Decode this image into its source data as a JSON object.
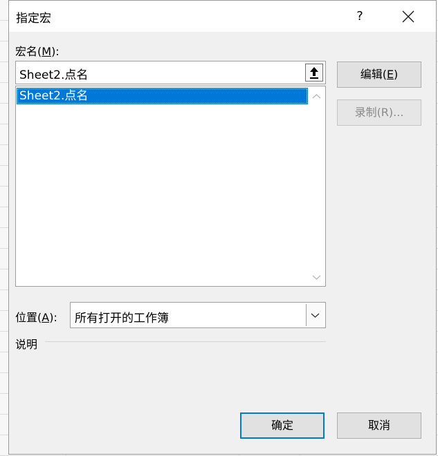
{
  "dialog": {
    "title": "指定宏",
    "help_label": "?",
    "macro_name_label_prefix": "宏名(",
    "macro_name_label_key": "M",
    "macro_name_label_suffix": "):",
    "macro_name_value": "Sheet2.点名",
    "macro_list": [
      "Sheet2.点名"
    ],
    "edit_button_prefix": "编辑(",
    "edit_button_key": "E",
    "edit_button_suffix": ")",
    "record_button": "录制(R)...",
    "location_label_prefix": "位置(",
    "location_label_key": "A",
    "location_label_suffix": "):",
    "location_value": "所有打开的工作簿",
    "description_label": "说明",
    "ok_button": "确定",
    "cancel_button": "取消"
  },
  "colors": {
    "selection": "#0078d7",
    "default_border": "#0078d7"
  }
}
